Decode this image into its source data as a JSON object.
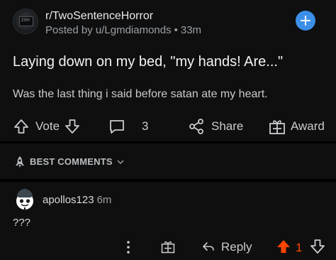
{
  "post": {
    "subreddit": "r/TwoSentenceHorror",
    "posted_by": "Posted by u/Lgmdiamonds",
    "age": "33m",
    "avatar_text": "2SH",
    "title": "Laying down on my bed, \"my hands! Are...\"",
    "body": "Was the last thing i said before satan ate my heart.",
    "vote_label": "Vote",
    "comment_count": "3",
    "share_label": "Share",
    "award_label": "Award"
  },
  "sort": {
    "label": "BEST COMMENTS"
  },
  "comment": {
    "username": "apollos123",
    "age": "6m",
    "body": "???",
    "reply_label": "Reply",
    "score": "1"
  },
  "colors": {
    "background": "#0f0f0f",
    "accent_blue": "#3b8fe8",
    "upvote_orange": "#ff4500"
  },
  "icons": [
    "join-plus-icon",
    "upvote-icon",
    "downvote-icon",
    "comment-icon",
    "share-icon",
    "award-icon",
    "rocket-icon",
    "chevron-down-icon",
    "more-icon"
  ]
}
